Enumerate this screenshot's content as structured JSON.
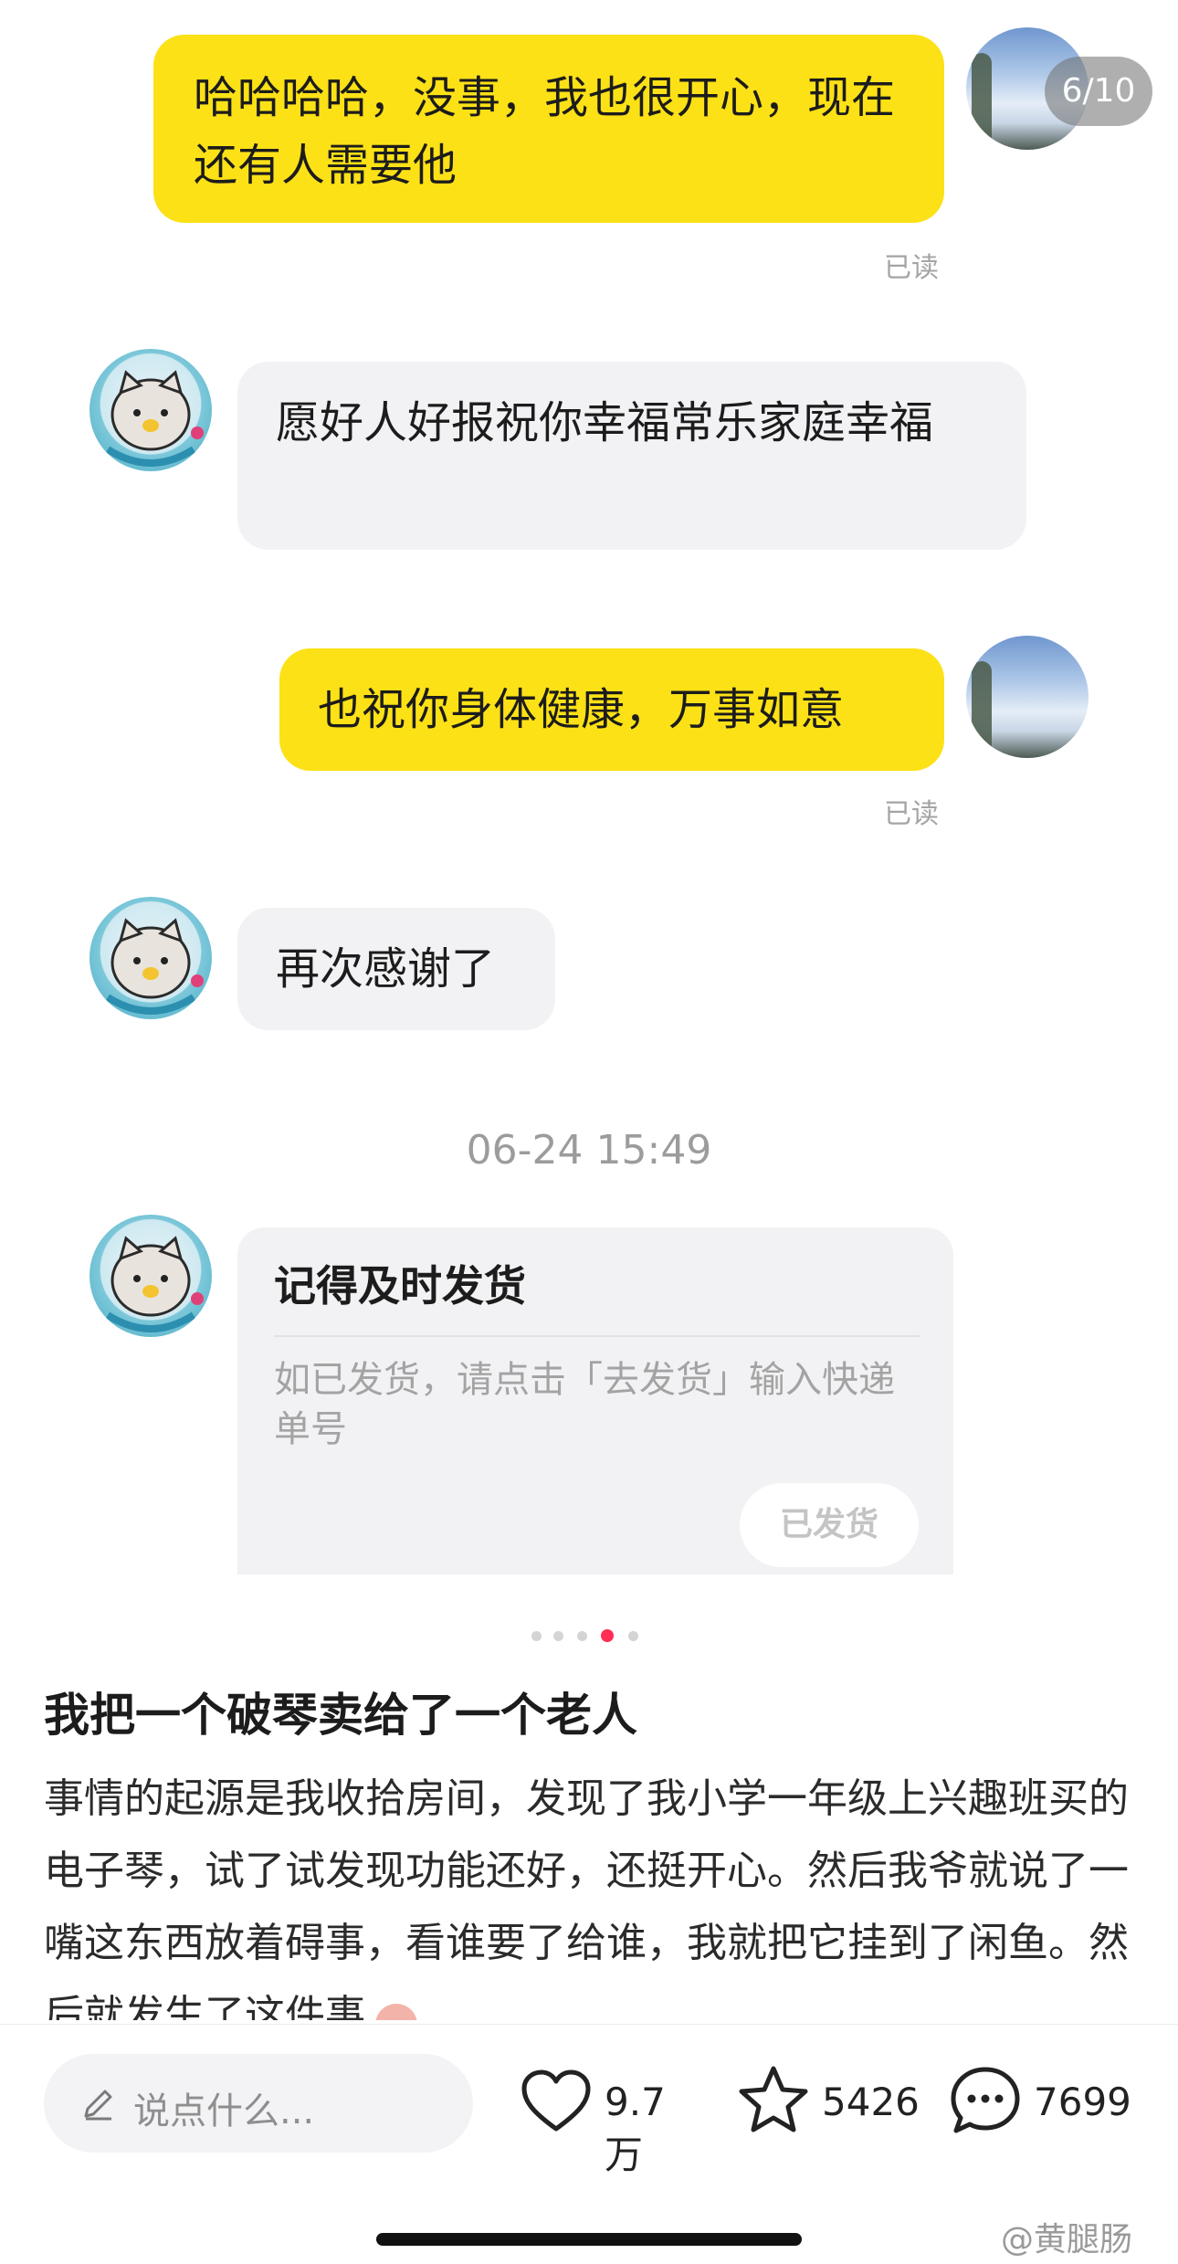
{
  "pager": {
    "label": "6/10"
  },
  "messages": [
    {
      "text": "哈哈哈哈，没事，我也很开心，现在还有人需要他"
    },
    {
      "text": "愿好人好报祝你幸福常乐家庭幸福"
    },
    {
      "text": "也祝你身体健康，万事如意"
    },
    {
      "text": "再次感谢了"
    }
  ],
  "read_status": "已读",
  "timestamp": "06-24 15:49",
  "ship_card": {
    "title": "记得及时发货",
    "desc": "如已发货，请点击「去发货」输入快递单号",
    "button": "已发货"
  },
  "post": {
    "title": "我把一个破琴卖给了一个老人",
    "body": "事情的起源是我收拾房间，发现了我小学一年级上兴趣班买的电子琴，试了试发现功能还好，还挺开心。然后我爷就说了一嘴这东西放着碍事，看谁要了给谁，我就把它挂到了闲鱼。然后就发生了这件事"
  },
  "carousel": {
    "count": 5,
    "active_index": 3
  },
  "bottom_bar": {
    "comment_placeholder": "说点什么...",
    "likes": "9.7万",
    "favorites": "5426",
    "comments": "7699"
  },
  "watermark": "@黄腿肠",
  "colors": {
    "self_bubble": "#fce116",
    "other_bubble": "#f2f2f4",
    "accent_dot": "#ff2d55"
  }
}
